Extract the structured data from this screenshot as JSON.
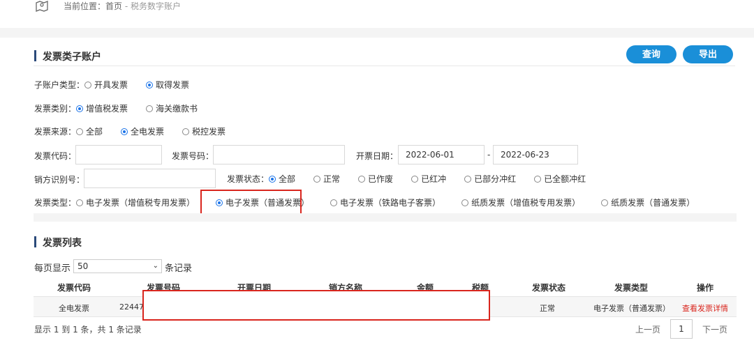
{
  "breadcrumb": {
    "prefix": "当前位置：首页",
    "current": " - 税务数字账户"
  },
  "section1": {
    "title": "发票类子账户",
    "query_label": "查询",
    "export_label": "导出"
  },
  "filters": {
    "account_type": {
      "label": "子账户类型：",
      "options": [
        "开具发票",
        "取得发票"
      ],
      "selected": 1
    },
    "invoice_category": {
      "label": "发票类别：",
      "options": [
        "增值税发票",
        "海关缴款书"
      ],
      "selected": 0
    },
    "invoice_source": {
      "label": "发票来源：",
      "options": [
        "全部",
        "全电发票",
        "税控发票"
      ],
      "selected": 1
    },
    "invoice_code_label": "发票代码：",
    "invoice_number_label": "发票号码：",
    "issue_date_label": "开票日期：",
    "date_start": "2022-06-01",
    "date_sep": "-",
    "date_end": "2022-06-23",
    "seller_id_label": "销方识别号：",
    "invoice_status": {
      "label": "发票状态：",
      "options": [
        "全部",
        "正常",
        "已作废",
        "已红冲",
        "已部分冲红",
        "已全额冲红"
      ],
      "selected": 0
    },
    "invoice_type": {
      "label": "发票类型：",
      "options": [
        "电子发票（增值税专用发票）",
        "电子发票（普通发票）",
        "电子发票（铁路电子客票）",
        "纸质发票（增值税专用发票）",
        "纸质发票（普通发票）"
      ],
      "selected": 1
    }
  },
  "section2": {
    "title": "发票列表"
  },
  "page_size": {
    "prefix": "每页显示",
    "value": "50",
    "suffix": "条记录"
  },
  "table": {
    "headers": [
      "发票代码",
      "发票号码",
      "开票日期",
      "销方名称",
      "金额",
      "税额",
      "发票状态",
      "发票类型",
      "操作"
    ],
    "rows": [
      {
        "code": "全电发票",
        "number": "22447",
        "status": "正常",
        "type": "电子发票（普通发票）",
        "action": "查看发票详情"
      }
    ]
  },
  "footer": {
    "summary": "显示 1 到 1 条，共 1 条记录",
    "prev": "上一页",
    "page": "1",
    "next": "下一页"
  },
  "colors": {
    "accent": "#1a8fd8",
    "highlight": "#d9251d",
    "radio": "#1a73e8"
  }
}
